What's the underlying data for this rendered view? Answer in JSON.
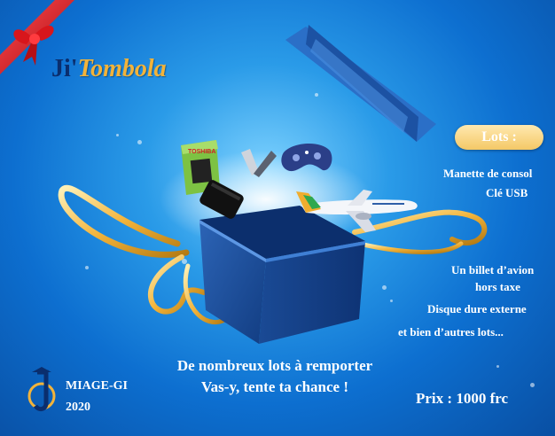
{
  "brand": {
    "prefix": "Ji'",
    "name": "Tombola"
  },
  "lots": {
    "title": "Lots :",
    "items": [
      "Manette de consol",
      "Clé USB",
      "Un billet d’avion",
      "hors taxe",
      "Disque dure externe",
      "et  bien d’autres lots..."
    ]
  },
  "tagline": {
    "line1": "De nombreux lots à remporter",
    "line2": "Vas-y, tente ta chance !"
  },
  "price": "Prix : 1000 frc",
  "organizer": {
    "name": "MIAGE-GI",
    "year": "2020"
  },
  "package_text": {
    "brand": "TOSHIBA"
  },
  "colors": {
    "background": "#0d6fd0",
    "gold": "#f2b33a",
    "ribbon": "#d8161c",
    "box": "#1d4f9c",
    "dark_navy": "#0a2e6e"
  }
}
